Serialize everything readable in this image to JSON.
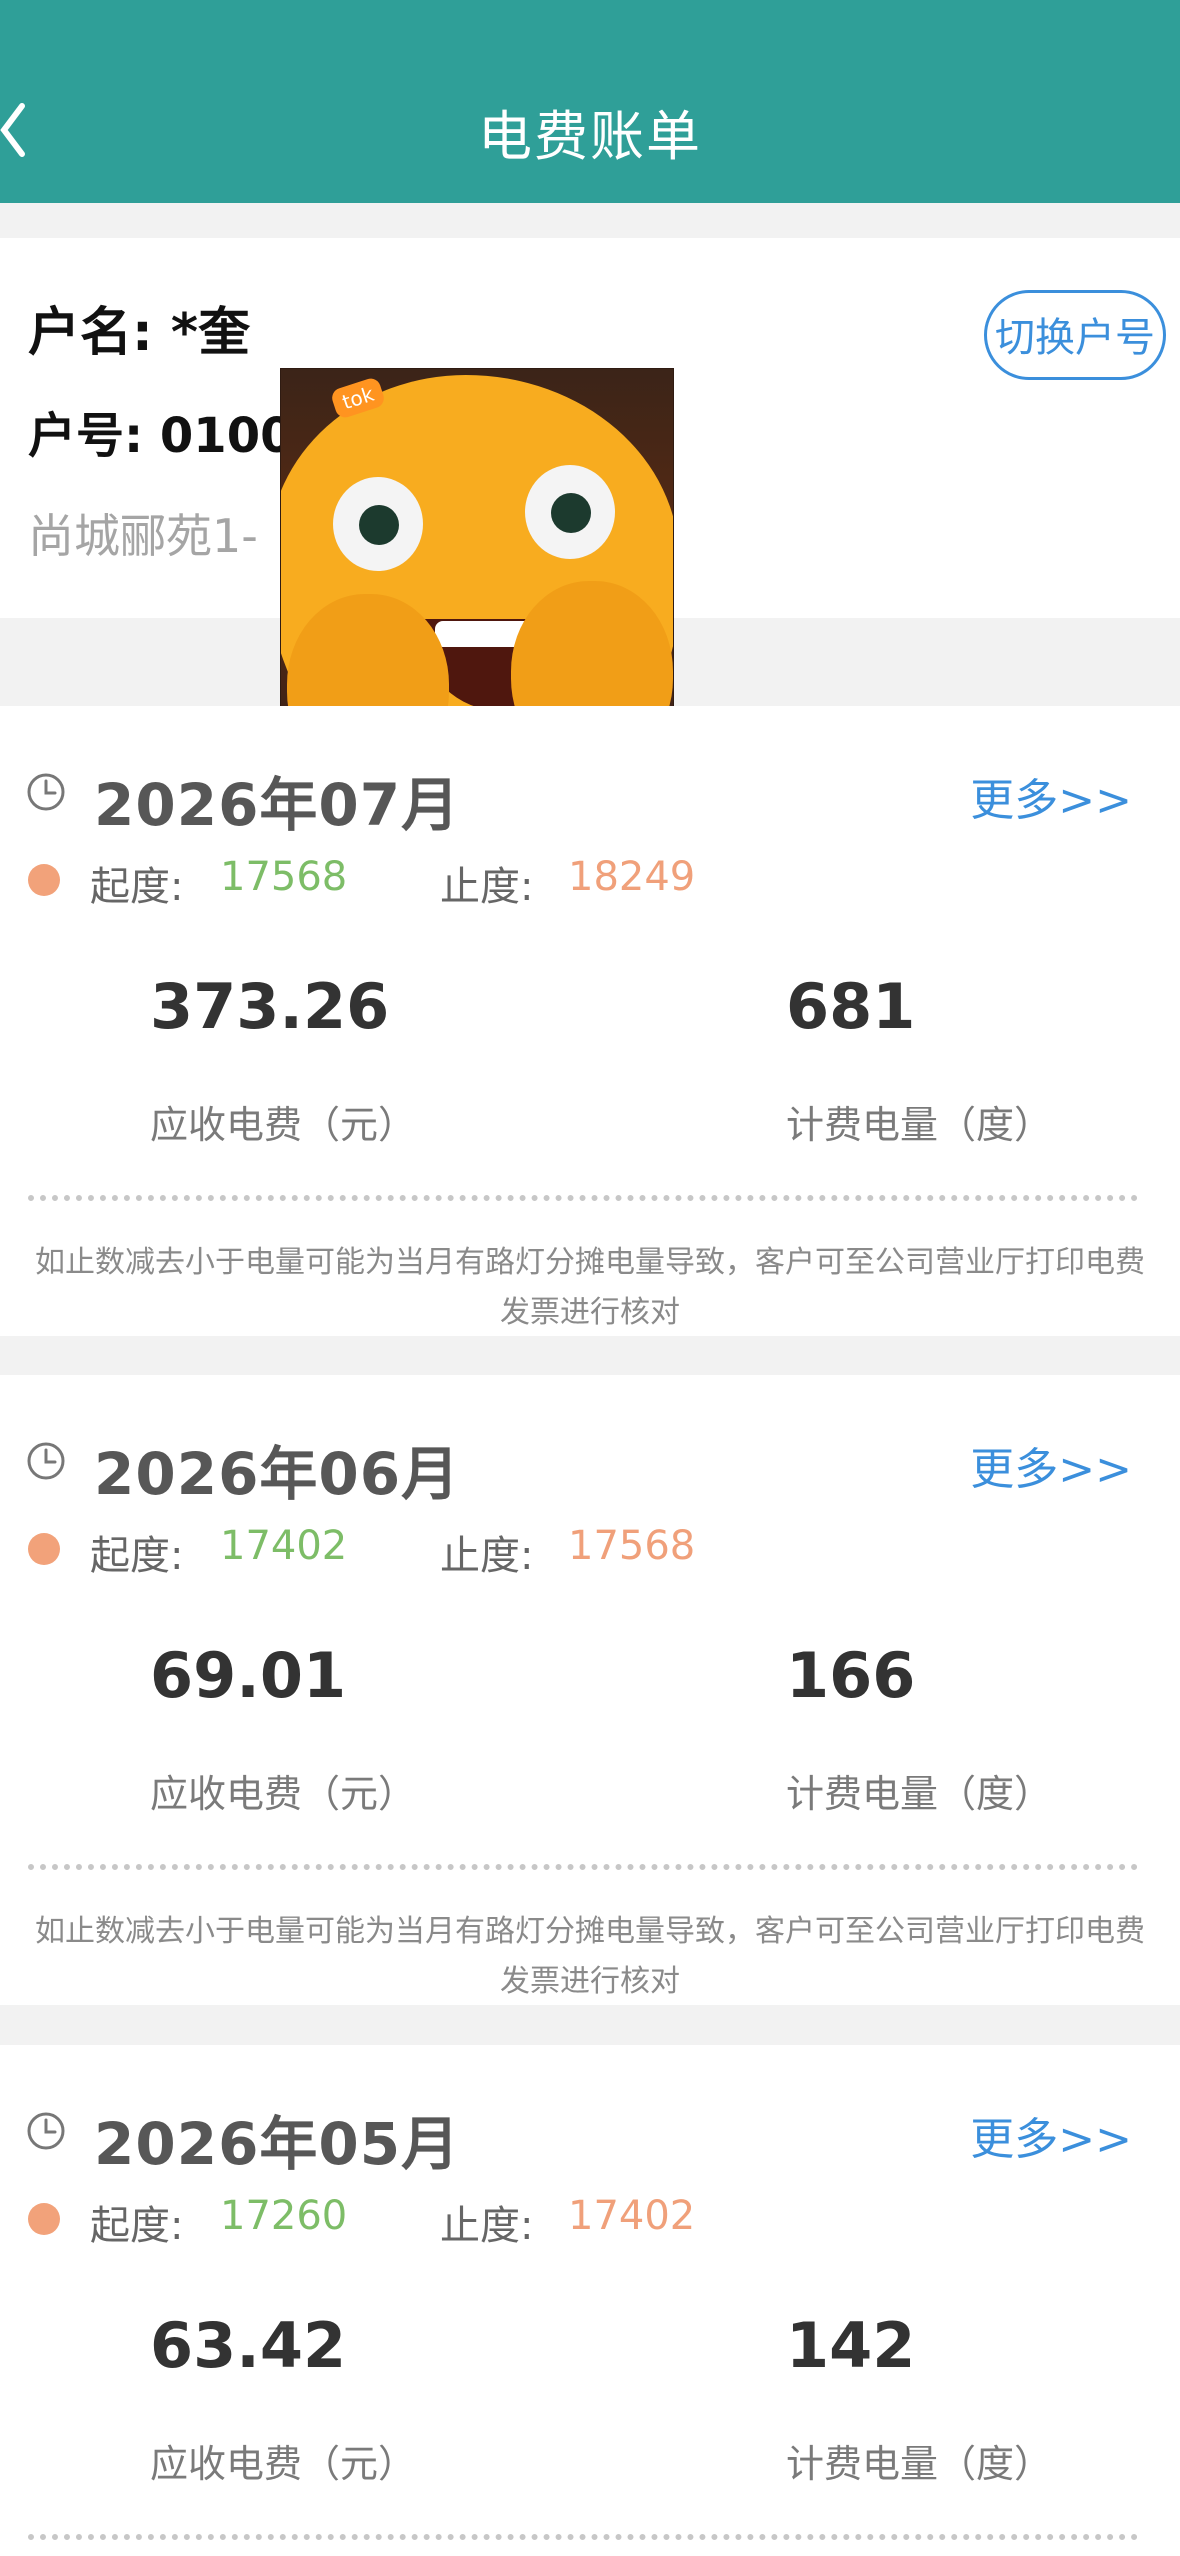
{
  "header": {
    "title": "电费账单",
    "back_icon": "chevron-left-icon"
  },
  "account": {
    "name_line": "户名: *奎",
    "number_line": "户号: 0100",
    "address_line": "尚城郦苑1-",
    "switch_button": "切换户号"
  },
  "overlay_sticker": {
    "brand": "tok"
  },
  "labels": {
    "start_reading": "起度:",
    "end_reading": "止度:",
    "more": "更多>>",
    "fee_due": "应收电费（元）",
    "billable_kwh": "计费电量（度）",
    "notice": "如止数减去小于电量可能为当月有路灯分摊电量导致，客户可至公司营业厅打印电费发票进行核对"
  },
  "bills": [
    {
      "month": "2026年07月",
      "start": "17568",
      "end": "18249",
      "fee": "373.26",
      "kwh": "681"
    },
    {
      "month": "2026年06月",
      "start": "17402",
      "end": "17568",
      "fee": "69.01",
      "kwh": "166"
    },
    {
      "month": "2026年05月",
      "start": "17260",
      "end": "17402",
      "fee": "63.42",
      "kwh": "142"
    }
  ],
  "colors": {
    "header": "#2f9f98",
    "accent": "#3b8fdc",
    "start_value": "#7dbd67",
    "end_value": "#f0a07a",
    "status_dot": "#f2a27a"
  }
}
